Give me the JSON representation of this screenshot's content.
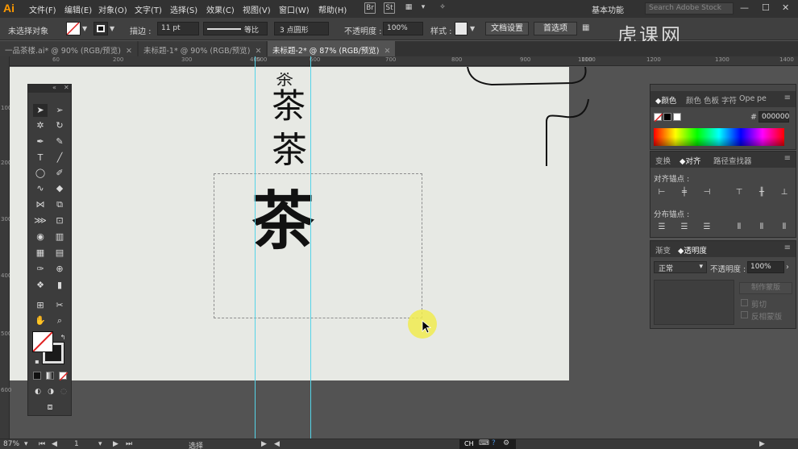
{
  "app": {
    "logo": "Ai"
  },
  "menu": [
    "文件(F)",
    "编辑(E)",
    "对象(O)",
    "文字(T)",
    "选择(S)",
    "效果(C)",
    "视图(V)",
    "窗口(W)",
    "帮助(H)"
  ],
  "menubar_icons": [
    "Br",
    "St"
  ],
  "workspace": "基本功能",
  "search_placeholder": "Search Adobe Stock",
  "watermark": "虎课网",
  "control": {
    "selection_label": "未选择对象",
    "stroke_label": "描边 :",
    "stroke_weight": "11 pt",
    "profile_label": "等比",
    "brush_label": "3 点圆形",
    "opacity_label": "不透明度 :",
    "opacity_value": "100%",
    "style_label": "样式 :",
    "doc_setup": "文档设置",
    "preferences": "首选项"
  },
  "tabs": [
    {
      "label": "一品茶楼.ai* @ 90% (RGB/预览)"
    },
    {
      "label": "未标题-1* @ 90% (RGB/预览)"
    },
    {
      "label": "未标题-2* @ 87% (RGB/预览)"
    }
  ],
  "ruler_top": [
    "60",
    "200",
    "300",
    "400",
    "500",
    "600",
    "700",
    "800",
    "900",
    "1000",
    "1100",
    "1200",
    "1300",
    "1400"
  ],
  "ruler_left": [
    "100",
    "200",
    "300",
    "400",
    "500",
    "600"
  ],
  "canvas": {
    "glyph": "茶"
  },
  "color_panel": {
    "tabs": [
      "颜色",
      "颜色",
      "色板",
      "字符",
      "Ope"
    ],
    "hex_prefix": "#",
    "hex": "000000"
  },
  "align_panel": {
    "tabs": [
      "变换",
      "对齐",
      "路径查找器"
    ],
    "align_label": "对齐锚点 :",
    "distribute_label": "分布锚点 :"
  },
  "transparency_panel": {
    "tabs": [
      "渐变",
      "透明度"
    ],
    "blend_mode": "正常",
    "opacity_label": "不透明度 :",
    "opacity_value": "100%",
    "make_mask": "制作蒙版",
    "clip": "剪切",
    "invert_mask": "反相蒙版"
  },
  "status": {
    "zoom": "87%",
    "page": "1",
    "tool": "选择",
    "ime": "CH"
  },
  "colors": {
    "accent": "#ff9a00",
    "guide": "#55d4e8",
    "artboard": "#e7e9e4"
  }
}
